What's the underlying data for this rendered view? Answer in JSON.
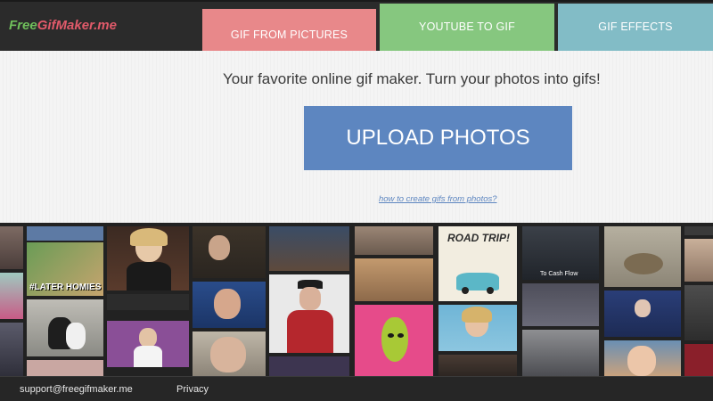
{
  "colors": {
    "header_bg": "#2b2b2b",
    "tab_pictures": "#e8888a",
    "tab_youtube": "#86c77f",
    "tab_effects": "#82bcc6",
    "upload_button": "#5d86c0",
    "link": "#5d86c0"
  },
  "logo": {
    "part1": "Free",
    "part2": "GifMaker",
    "part3": ".me"
  },
  "tabs": [
    {
      "label": "GIF FROM PICTURES",
      "active": true
    },
    {
      "label": "YOUTUBE TO GIF",
      "active": false
    },
    {
      "label": "GIF EFFECTS",
      "active": false
    }
  ],
  "main": {
    "tagline": "Your favorite online gif maker. Turn your photos into gifs!",
    "upload_label": "UPLOAD PHOTOS",
    "howto_link": "how to create gifs from photos?"
  },
  "gallery": {
    "captions": {
      "later_homies": "#LATER HOMIES",
      "road_trip": "ROAD TRIP!",
      "to_cash_flow": "To Cash Flow"
    }
  },
  "footer": {
    "support_email": "support@freegifmaker.me",
    "privacy": "Privacy"
  }
}
